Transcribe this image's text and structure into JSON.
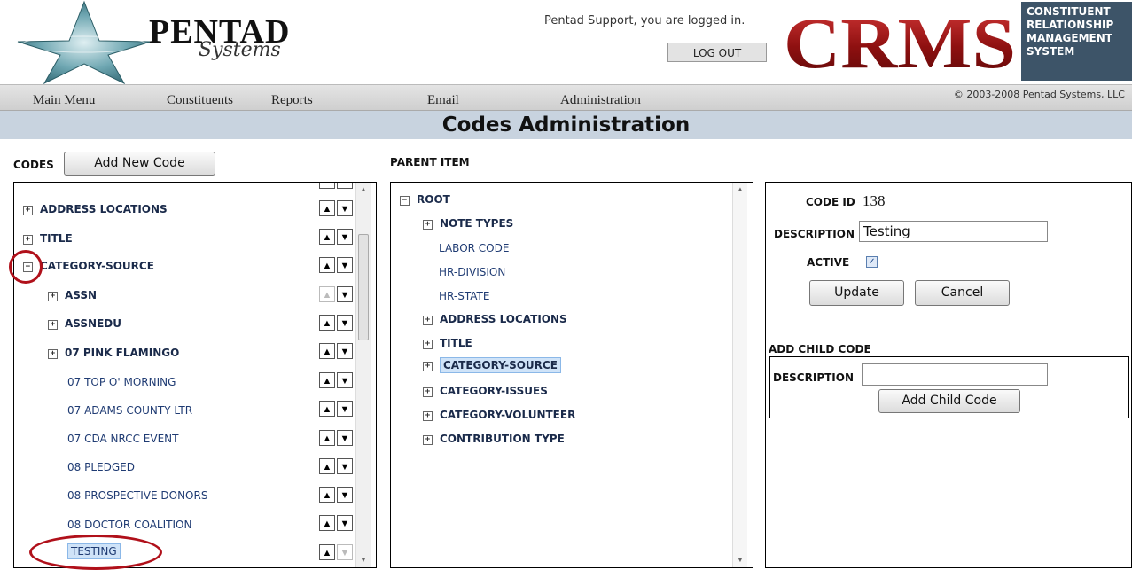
{
  "header": {
    "brand_name": "PENTAD",
    "brand_sub": "Systems",
    "logged_in_text": "Pentad Support, you are logged in.",
    "logout_label": "LOG OUT",
    "crms_logo": "CRMS",
    "crms_tagline": [
      "CONSTITUENT",
      "RELATIONSHIP",
      "MANAGEMENT",
      "SYSTEM"
    ]
  },
  "nav": {
    "items": [
      "Main Menu",
      "Constituents",
      "Reports",
      "Email",
      "Administration"
    ],
    "copyright": "© 2003-2008 Pentad Systems, LLC"
  },
  "page_title": "Codes Administration",
  "codes": {
    "label": "CODES",
    "add_button": "Add New Code",
    "items": [
      {
        "label": "ADDRESS LOCATIONS",
        "expand": "+",
        "level": 0
      },
      {
        "label": "TITLE",
        "expand": "+",
        "level": 0
      },
      {
        "label": "CATEGORY-SOURCE",
        "expand": "−",
        "level": 0
      },
      {
        "label": "ASSN",
        "expand": "+",
        "level": 1
      },
      {
        "label": "ASSNEDU",
        "expand": "+",
        "level": 1
      },
      {
        "label": "07 PINK FLAMINGO",
        "expand": "+",
        "level": 1
      },
      {
        "label": "07 TOP O' MORNING",
        "level": 2
      },
      {
        "label": "07 ADAMS COUNTY LTR",
        "level": 2
      },
      {
        "label": "07 CDA NRCC EVENT",
        "level": 2
      },
      {
        "label": "08 PLEDGED",
        "level": 2
      },
      {
        "label": "08 PROSPECTIVE DONORS",
        "level": 2
      },
      {
        "label": "08 DOCTOR COALITION",
        "level": 2
      },
      {
        "label": "TESTING",
        "level": 2,
        "selected": true
      }
    ],
    "up_arrow": "▲",
    "down_arrow": "▼"
  },
  "parent": {
    "label": "PARENT ITEM",
    "items": [
      {
        "label": "ROOT",
        "expand": "−"
      },
      {
        "label": "NOTE TYPES",
        "expand": "+"
      },
      {
        "label": "LABOR CODE"
      },
      {
        "label": "HR-DIVISION"
      },
      {
        "label": "HR-STATE"
      },
      {
        "label": "ADDRESS LOCATIONS",
        "expand": "+"
      },
      {
        "label": "TITLE",
        "expand": "+"
      },
      {
        "label": "CATEGORY-SOURCE",
        "expand": "+",
        "selected": true
      },
      {
        "label": "CATEGORY-ISSUES",
        "expand": "+"
      },
      {
        "label": "CATEGORY-VOLUNTEER",
        "expand": "+"
      },
      {
        "label": "CONTRIBUTION TYPE",
        "expand": "+"
      }
    ]
  },
  "detail": {
    "code_id_label": "CODE ID",
    "code_id_value": "138",
    "description_label": "DESCRIPTION",
    "description_value": "Testing",
    "active_label": "ACTIVE",
    "active_checked": true,
    "update_button": "Update",
    "cancel_button": "Cancel",
    "add_child_label": "ADD CHILD CODE",
    "child_description_label": "DESCRIPTION",
    "child_description_value": "",
    "add_child_button": "Add Child Code"
  },
  "colors": {
    "title_bar": "#c8d3df",
    "crms_red": "#a01818",
    "highlight": "#cfe3f8",
    "annotation_red": "#b0101a"
  }
}
